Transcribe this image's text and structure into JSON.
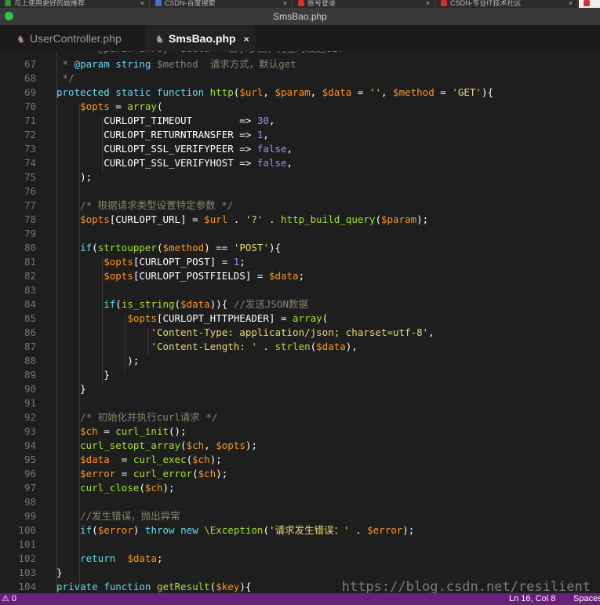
{
  "browser_tabs": [
    {
      "label": "与上使用更好的题推荐"
    },
    {
      "label": "CSDN-百度搜索"
    },
    {
      "label": "账号登录"
    },
    {
      "label": "CSDN-专业IT技术社区"
    }
  ],
  "window": {
    "title": "SmsBao.php"
  },
  "editor_tabs": [
    {
      "label": "UserController.php",
      "icon": "elephant-icon",
      "active": false
    },
    {
      "label": "SmsBao.php",
      "icon": "elephant-icon",
      "active": true,
      "close": "×"
    }
  ],
  "lines": [
    {
      "n": "67",
      "tokens": [
        [
          "cmt",
          " * "
        ],
        [
          "kw",
          "@param"
        ],
        [
          "cmt",
          " "
        ],
        [
          "kw",
          "string"
        ],
        [
          "cmt",
          " $method  请求方式，默认get"
        ]
      ]
    },
    {
      "n": "68",
      "tokens": [
        [
          "cmt",
          " */"
        ]
      ]
    },
    {
      "n": "69",
      "tokens": [
        [
          "kw",
          "protected static function "
        ],
        [
          "fn",
          "http"
        ],
        [
          "pl",
          "("
        ],
        [
          "var",
          "$url"
        ],
        [
          "pl",
          ", "
        ],
        [
          "var",
          "$param"
        ],
        [
          "pl",
          ", "
        ],
        [
          "var",
          "$data"
        ],
        [
          "pl",
          " = "
        ],
        [
          "str",
          "''"
        ],
        [
          "pl",
          ", "
        ],
        [
          "var",
          "$method"
        ],
        [
          "pl",
          " = "
        ],
        [
          "str",
          "'GET'"
        ],
        [
          "pl",
          "){"
        ]
      ]
    },
    {
      "n": "70",
      "tokens": [
        [
          "pl",
          "    "
        ],
        [
          "var",
          "$opts"
        ],
        [
          "pl",
          " = "
        ],
        [
          "fn",
          "array"
        ],
        [
          "pl",
          "("
        ]
      ]
    },
    {
      "n": "71",
      "tokens": [
        [
          "pl",
          "        CURLOPT_TIMEOUT        => "
        ],
        [
          "num",
          "30"
        ],
        [
          "pl",
          ","
        ]
      ]
    },
    {
      "n": "72",
      "tokens": [
        [
          "pl",
          "        CURLOPT_RETURNTRANSFER => "
        ],
        [
          "num",
          "1"
        ],
        [
          "pl",
          ","
        ]
      ]
    },
    {
      "n": "73",
      "tokens": [
        [
          "pl",
          "        CURLOPT_SSL_VERIFYPEER => "
        ],
        [
          "bool",
          "false"
        ],
        [
          "pl",
          ","
        ]
      ]
    },
    {
      "n": "74",
      "tokens": [
        [
          "pl",
          "        CURLOPT_SSL_VERIFYHOST => "
        ],
        [
          "bool",
          "false"
        ],
        [
          "pl",
          ","
        ]
      ]
    },
    {
      "n": "75",
      "tokens": [
        [
          "pl",
          "    );"
        ]
      ]
    },
    {
      "n": "76",
      "tokens": []
    },
    {
      "n": "77",
      "tokens": [
        [
          "pl",
          "    "
        ],
        [
          "cmt",
          "/* 根据请求类型设置特定参数 */"
        ]
      ]
    },
    {
      "n": "78",
      "tokens": [
        [
          "pl",
          "    "
        ],
        [
          "var",
          "$opts"
        ],
        [
          "pl",
          "[CURLOPT_URL] = "
        ],
        [
          "var",
          "$url"
        ],
        [
          "pl",
          " . "
        ],
        [
          "str",
          "'?'"
        ],
        [
          "pl",
          " . "
        ],
        [
          "fn",
          "http_build_query"
        ],
        [
          "pl",
          "("
        ],
        [
          "var",
          "$param"
        ],
        [
          "pl",
          ");"
        ]
      ]
    },
    {
      "n": "79",
      "tokens": []
    },
    {
      "n": "80",
      "tokens": [
        [
          "pl",
          "    "
        ],
        [
          "kw",
          "if"
        ],
        [
          "pl",
          "("
        ],
        [
          "fn",
          "strtoupper"
        ],
        [
          "pl",
          "("
        ],
        [
          "var",
          "$method"
        ],
        [
          "pl",
          ") == "
        ],
        [
          "str",
          "'POST'"
        ],
        [
          "pl",
          "){"
        ]
      ]
    },
    {
      "n": "81",
      "tokens": [
        [
          "pl",
          "        "
        ],
        [
          "var",
          "$opts"
        ],
        [
          "pl",
          "[CURLOPT_POST] = "
        ],
        [
          "num",
          "1"
        ],
        [
          "pl",
          ";"
        ]
      ]
    },
    {
      "n": "82",
      "tokens": [
        [
          "pl",
          "        "
        ],
        [
          "var",
          "$opts"
        ],
        [
          "pl",
          "[CURLOPT_POSTFIELDS] = "
        ],
        [
          "var",
          "$data"
        ],
        [
          "pl",
          ";"
        ]
      ]
    },
    {
      "n": "83",
      "tokens": []
    },
    {
      "n": "84",
      "tokens": [
        [
          "pl",
          "        "
        ],
        [
          "kw",
          "if"
        ],
        [
          "pl",
          "("
        ],
        [
          "fn",
          "is_string"
        ],
        [
          "pl",
          "("
        ],
        [
          "var",
          "$data"
        ],
        [
          "pl",
          ")){ "
        ],
        [
          "cmt",
          "//发送JSON数据"
        ]
      ]
    },
    {
      "n": "85",
      "tokens": [
        [
          "pl",
          "            "
        ],
        [
          "var",
          "$opts"
        ],
        [
          "pl",
          "[CURLOPT_HTTPHEADER] = "
        ],
        [
          "fn",
          "array"
        ],
        [
          "pl",
          "("
        ]
      ]
    },
    {
      "n": "86",
      "tokens": [
        [
          "pl",
          "                "
        ],
        [
          "str",
          "'Content-Type: application/json; charset=utf-8'"
        ],
        [
          "pl",
          ","
        ]
      ]
    },
    {
      "n": "87",
      "tokens": [
        [
          "pl",
          "                "
        ],
        [
          "str",
          "'Content-Length: '"
        ],
        [
          "pl",
          " . "
        ],
        [
          "fn",
          "strlen"
        ],
        [
          "pl",
          "("
        ],
        [
          "var",
          "$data"
        ],
        [
          "pl",
          "),"
        ]
      ]
    },
    {
      "n": "88",
      "tokens": [
        [
          "pl",
          "            );"
        ]
      ]
    },
    {
      "n": "89",
      "tokens": [
        [
          "pl",
          "        }"
        ]
      ]
    },
    {
      "n": "90",
      "tokens": [
        [
          "pl",
          "    }"
        ]
      ]
    },
    {
      "n": "91",
      "tokens": []
    },
    {
      "n": "92",
      "tokens": [
        [
          "pl",
          "    "
        ],
        [
          "cmt",
          "/* 初始化并执行curl请求 */"
        ]
      ]
    },
    {
      "n": "93",
      "tokens": [
        [
          "pl",
          "    "
        ],
        [
          "var",
          "$ch"
        ],
        [
          "pl",
          " = "
        ],
        [
          "fn",
          "curl_init"
        ],
        [
          "pl",
          "();"
        ]
      ]
    },
    {
      "n": "94",
      "tokens": [
        [
          "pl",
          "    "
        ],
        [
          "fn",
          "curl_setopt_array"
        ],
        [
          "pl",
          "("
        ],
        [
          "var",
          "$ch"
        ],
        [
          "pl",
          ", "
        ],
        [
          "var",
          "$opts"
        ],
        [
          "pl",
          ");"
        ]
      ]
    },
    {
      "n": "95",
      "tokens": [
        [
          "pl",
          "    "
        ],
        [
          "var",
          "$data"
        ],
        [
          "pl",
          "  = "
        ],
        [
          "fn",
          "curl_exec"
        ],
        [
          "pl",
          "("
        ],
        [
          "var",
          "$ch"
        ],
        [
          "pl",
          ");"
        ]
      ]
    },
    {
      "n": "96",
      "tokens": [
        [
          "pl",
          "    "
        ],
        [
          "var",
          "$error"
        ],
        [
          "pl",
          " = "
        ],
        [
          "fn",
          "curl_error"
        ],
        [
          "pl",
          "("
        ],
        [
          "var",
          "$ch"
        ],
        [
          "pl",
          ");"
        ]
      ]
    },
    {
      "n": "97",
      "tokens": [
        [
          "pl",
          "    "
        ],
        [
          "fn",
          "curl_close"
        ],
        [
          "pl",
          "("
        ],
        [
          "var",
          "$ch"
        ],
        [
          "pl",
          ");"
        ]
      ]
    },
    {
      "n": "98",
      "tokens": []
    },
    {
      "n": "99",
      "tokens": [
        [
          "pl",
          "    "
        ],
        [
          "cmt",
          "//发生错误，抛出异常"
        ]
      ]
    },
    {
      "n": "100",
      "tokens": [
        [
          "pl",
          "    "
        ],
        [
          "kw",
          "if"
        ],
        [
          "pl",
          "("
        ],
        [
          "var",
          "$error"
        ],
        [
          "pl",
          ") "
        ],
        [
          "kw",
          "throw new "
        ],
        [
          "fn",
          "\\Exception"
        ],
        [
          "pl",
          "("
        ],
        [
          "str",
          "'请求发生错误：'"
        ],
        [
          "pl",
          " . "
        ],
        [
          "var",
          "$error"
        ],
        [
          "pl",
          ");"
        ]
      ]
    },
    {
      "n": "101",
      "tokens": []
    },
    {
      "n": "102",
      "tokens": [
        [
          "pl",
          "    "
        ],
        [
          "kw",
          "return"
        ],
        [
          "pl",
          "  "
        ],
        [
          "var",
          "$data"
        ],
        [
          "pl",
          ";"
        ]
      ]
    },
    {
      "n": "103",
      "tokens": [
        [
          "pl",
          "}"
        ]
      ]
    },
    {
      "n": "104",
      "tokens": [
        [
          "kw",
          "private function "
        ],
        [
          "fn",
          "getResult"
        ],
        [
          "pl",
          "("
        ],
        [
          "var",
          "$key"
        ],
        [
          "pl",
          "){"
        ]
      ]
    }
  ],
  "watermark": "https://blog.csdn.net/resilient",
  "status": {
    "left": "⚠ 0",
    "position": "Ln 16, Col 8",
    "spaces": "Spaces"
  },
  "colors": {
    "status_bar": "#68217a",
    "keyword": "#66d9ef",
    "variable": "#fd971f",
    "string": "#e6db74",
    "function": "#a6e22e",
    "comment": "#88846f"
  }
}
